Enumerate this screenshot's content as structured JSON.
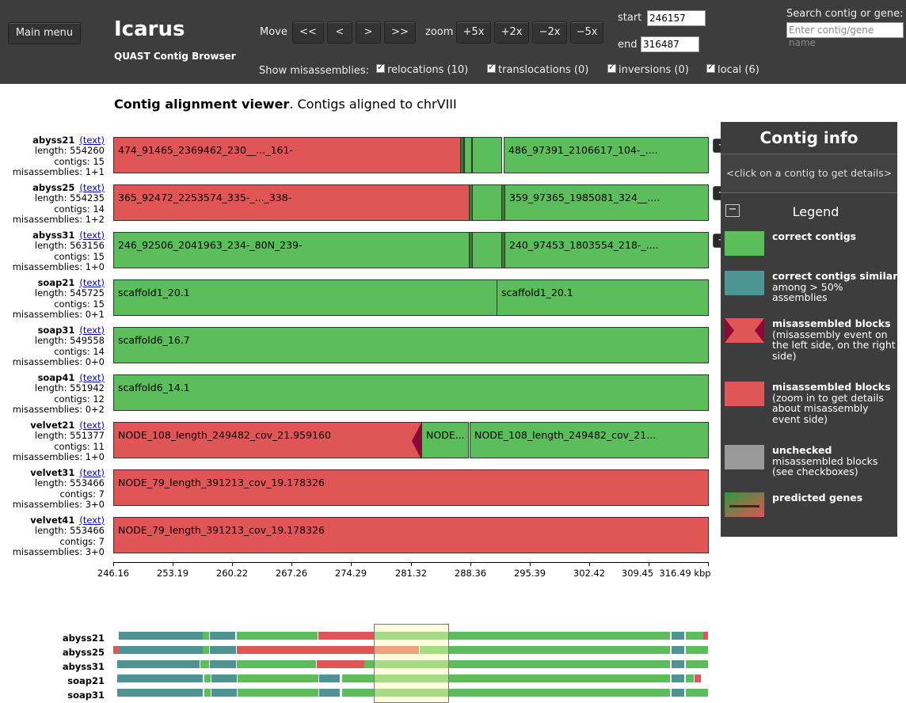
{
  "header": {
    "main_menu": "Main menu",
    "app_title": "Icarus",
    "app_subtitle": "QUAST Contig Browser",
    "move_label": "Move",
    "move_buttons": [
      "<<",
      "<",
      ">",
      ">>"
    ],
    "zoom_label": "zoom",
    "zoom_buttons": [
      "+5x",
      "+2x",
      "−2x",
      "−5x"
    ],
    "start_label": "start",
    "start_value": "246157",
    "end_label": "end",
    "end_value": "316487",
    "search_label": "Search contig or gene:",
    "search_placeholder": "Enter contig/gene name",
    "show_label": "Show misassemblies:",
    "checkboxes": [
      {
        "label": "relocations (10)",
        "checked": true
      },
      {
        "label": "translocations (0)",
        "checked": true
      },
      {
        "label": "inversions (0)",
        "checked": true
      },
      {
        "label": "local (6)",
        "checked": true
      }
    ]
  },
  "viewer": {
    "title_bold": "Contig alignment viewer",
    "title_rest": ". Contigs aligned to chrVIII"
  },
  "assemblies": [
    {
      "name": "abyss21",
      "text_link": "(text)",
      "length": "length: 554260",
      "contigs": "contigs: 15",
      "misassemblies": "misassemblies: 1+1",
      "has_plus": true,
      "blocks": [
        {
          "label": "474_91465_2369462_230__..._161-",
          "color": "red"
        },
        {
          "label": "",
          "color": "green"
        },
        {
          "label": "",
          "color": "green"
        },
        {
          "label": "486_97391_2106617_104-_....",
          "color": "green"
        }
      ]
    },
    {
      "name": "abyss25",
      "text_link": "(text)",
      "length": "length: 554235",
      "contigs": "contigs: 14",
      "misassemblies": "misassemblies: 1+2",
      "has_plus": true,
      "blocks": [
        {
          "label": "365_92472_2253574_335-_..._338-",
          "color": "red"
        },
        {
          "label": "",
          "color": "green"
        },
        {
          "label": "",
          "color": "green"
        },
        {
          "label": "359_97365_1985081_324__....",
          "color": "green"
        }
      ]
    },
    {
      "name": "abyss31",
      "text_link": "(text)",
      "length": "length: 563156",
      "contigs": "contigs: 15",
      "misassemblies": "misassemblies: 1+0",
      "has_plus": true,
      "blocks": [
        {
          "label": "246_92506_2041963_234-_80N_239-",
          "color": "green"
        },
        {
          "label": "",
          "color": "green"
        },
        {
          "label": "",
          "color": "green"
        },
        {
          "label": "240_97453_1803554_218-_....",
          "color": "green"
        }
      ]
    },
    {
      "name": "soap21",
      "text_link": "(text)",
      "length": "length: 545725",
      "contigs": "contigs: 15",
      "misassemblies": "misassemblies: 0+1",
      "has_plus": false,
      "blocks": [
        {
          "label": "scaffold1_20.1",
          "color": "green"
        },
        {
          "label": "scaffold1_20.1",
          "color": "green"
        }
      ]
    },
    {
      "name": "soap31",
      "text_link": "(text)",
      "length": "length: 549558",
      "contigs": "contigs: 14",
      "misassemblies": "misassemblies: 0+0",
      "has_plus": false,
      "blocks": [
        {
          "label": "scaffold6_16.7",
          "color": "green"
        }
      ]
    },
    {
      "name": "soap41",
      "text_link": "(text)",
      "length": "length: 551942",
      "contigs": "contigs: 12",
      "misassemblies": "misassemblies: 0+2",
      "has_plus": false,
      "blocks": [
        {
          "label": "scaffold6_14.1",
          "color": "green"
        }
      ]
    },
    {
      "name": "velvet21",
      "text_link": "(text)",
      "length": "length: 551377",
      "contigs": "contigs: 11",
      "misassemblies": "misassemblies: 1+0",
      "has_plus": false,
      "blocks": [
        {
          "label": "NODE_108_length_249482_cov_21.959160",
          "color": "red"
        },
        {
          "label": "NODE...",
          "color": "green"
        },
        {
          "label": "NODE_108_length_249482_cov_21...",
          "color": "green"
        }
      ]
    },
    {
      "name": "velvet31",
      "text_link": "(text)",
      "length": "length: 553466",
      "contigs": "contigs: 7",
      "misassemblies": "misassemblies: 3+0",
      "has_plus": false,
      "blocks": [
        {
          "label": "NODE_79_length_391213_cov_19.178326",
          "color": "red"
        }
      ]
    },
    {
      "name": "velvet41",
      "text_link": "(text)",
      "length": "length: 553466",
      "contigs": "contigs: 7",
      "misassemblies": "misassemblies: 3+0",
      "has_plus": false,
      "blocks": [
        {
          "label": "NODE_79_length_391213_cov_19.178326",
          "color": "red"
        }
      ]
    }
  ],
  "axis": {
    "ticks": [
      "246.16",
      "253.19",
      "260.22",
      "267.26",
      "274.29",
      "281.32",
      "288.36",
      "295.39",
      "302.42",
      "309.45",
      "316.49 kbp"
    ]
  },
  "info_panel": {
    "title": "Contig info",
    "body": "<click on a contig to get details>",
    "legend_toggle": "−",
    "legend_title": "Legend",
    "legend_items": [
      {
        "bold": "correct contigs",
        "text": "",
        "swatch": "green"
      },
      {
        "bold": "correct contigs similar",
        "text": "among > 50% assemblies",
        "swatch": "teal"
      },
      {
        "bold": "misassembled blocks",
        "text": "(misassembly event on the left side, on the right side)",
        "swatch": "red-mis"
      },
      {
        "bold": "misassembled blocks",
        "text": "(zoom in to get details about misassembly event side)",
        "swatch": "red"
      },
      {
        "bold": "unchecked",
        "text": "misassembled blocks (see checkboxes)",
        "swatch": "gray"
      },
      {
        "bold": "predicted genes",
        "text": "",
        "swatch": "genes"
      }
    ]
  },
  "overview": {
    "rows": [
      "abyss21",
      "abyss25",
      "abyss31",
      "soap21",
      "soap31"
    ]
  },
  "colors": {
    "correct": "#5bbe5a",
    "similar": "#4f9494",
    "misassembled": "#e05555",
    "unchecked": "#999999",
    "panel": "#3d3d3d"
  }
}
